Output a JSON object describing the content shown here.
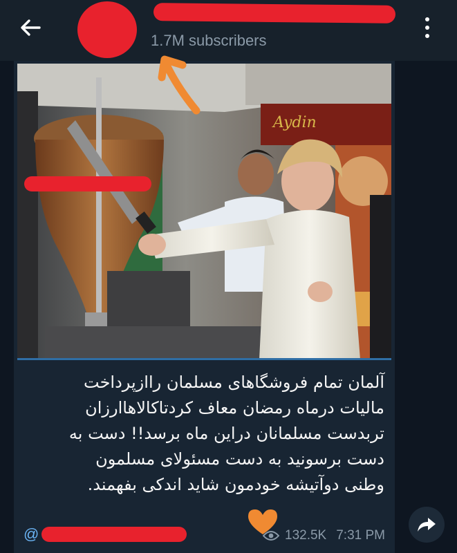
{
  "header": {
    "subscribers": "1.7M subscribers"
  },
  "post": {
    "caption": [
      "آلمان تمام فروشگاهای مسلمان راازپرداخت",
      "مالیات درماه رمضان معاف کردتاکالاهاارزان",
      "تربدست مسلمانان دراین ماه برسد!! دست به",
      "دست برسونید به دست مسئولای مسلمون",
      "وطنی دوآتیشه خودمون شاید اندکی بفهمند."
    ],
    "footer": {
      "at_symbol": "@",
      "views": "132.5K",
      "time": "7:31 PM"
    }
  },
  "colors": {
    "header_bg": "#17212b",
    "post_bg": "#182533",
    "accent": "#6ab3f3",
    "redaction": "#e8222d",
    "annotation": "#f08a32"
  },
  "icons": {
    "back": "back-arrow-icon",
    "menu": "more-vertical-icon",
    "views": "eye-icon",
    "share": "share-icon"
  }
}
